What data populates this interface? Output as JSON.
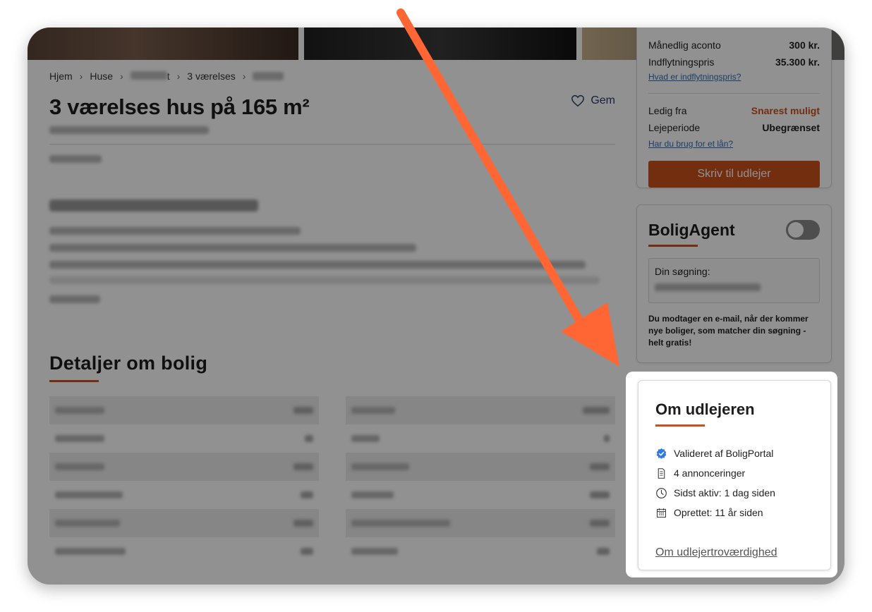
{
  "breadcrumb": {
    "home": "Hjem",
    "houses": "Huse",
    "city_suffix": "t",
    "rooms": "3 værelses"
  },
  "listing": {
    "title": "3 værelses hus på 165 m²",
    "save_label": "Gem"
  },
  "details": {
    "heading": "Detaljer om bolig"
  },
  "price_card": {
    "monthly_aconto_label": "Månedlig aconto",
    "monthly_aconto_value": "300 kr.",
    "move_in_price_label": "Indflytningspris",
    "move_in_price_value": "35.300 kr.",
    "move_in_link": "Hvad er indflytningspris?",
    "available_label": "Ledig fra",
    "available_value": "Snarest muligt",
    "period_label": "Lejeperiode",
    "period_value": "Ubegrænset",
    "loan_link": "Har du brug for et lån?",
    "contact_button": "Skriv til udlejer"
  },
  "agent_card": {
    "title": "BoligAgent",
    "search_label": "Din søgning:",
    "note": "Du modtager en e-mail, når der kommer nye boliger, som matcher din søgning - helt gratis!"
  },
  "landlord_card": {
    "title": "Om udlejeren",
    "items": [
      {
        "icon": "verified-badge-icon",
        "text": "Valideret af BoligPortal"
      },
      {
        "icon": "document-icon",
        "text": "4 annonceringer"
      },
      {
        "icon": "clock-icon",
        "text": "Sidst aktiv: 1 dag siden"
      },
      {
        "icon": "calendar-icon",
        "text": "Oprettet: 11 år siden"
      }
    ],
    "trust_link": "Om udlejertroværdighed"
  },
  "colors": {
    "accent": "#c9511b",
    "link": "#2f6db5",
    "annotation_arrow": "#ff6633",
    "verified_blue": "#2f7be0"
  }
}
